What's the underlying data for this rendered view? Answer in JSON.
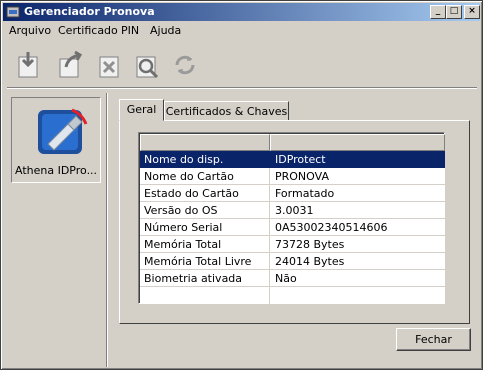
{
  "window": {
    "title": "Gerenciador Pronova",
    "controls": {
      "minimize": "_",
      "maximize": "□",
      "close": "×"
    }
  },
  "menu": [
    "Arquivo",
    "Certificado",
    "PIN",
    "Ajuda"
  ],
  "toolbar": {
    "icons": [
      "import-certificate-icon",
      "export-certificate-icon",
      "delete-certificate-icon",
      "view-certificate-icon",
      "refresh-icon"
    ]
  },
  "device": {
    "label": "Athena IDPro..."
  },
  "tabs": {
    "geral": "Geral",
    "certificados": "Certificados & Chaves"
  },
  "properties": [
    {
      "name": "Nome do disp.",
      "value": "IDProtect"
    },
    {
      "name": "Nome do Cartão",
      "value": "PRONOVA"
    },
    {
      "name": "Estado do Cartão",
      "value": "Formatado"
    },
    {
      "name": "Versão do OS",
      "value": "3.0031"
    },
    {
      "name": "Número Serial",
      "value": "0A53002340514606"
    },
    {
      "name": "Memória Total",
      "value": "73728 Bytes"
    },
    {
      "name": "Memória Total Livre",
      "value": "24014 Bytes"
    },
    {
      "name": "Biometria ativada",
      "value": "Não"
    }
  ],
  "buttons": {
    "close": "Fechar"
  },
  "colors": {
    "titlebar_start": "#0a246a",
    "titlebar_end": "#a6caf0",
    "selection": "#0a246a",
    "face": "#d4d0c8"
  }
}
